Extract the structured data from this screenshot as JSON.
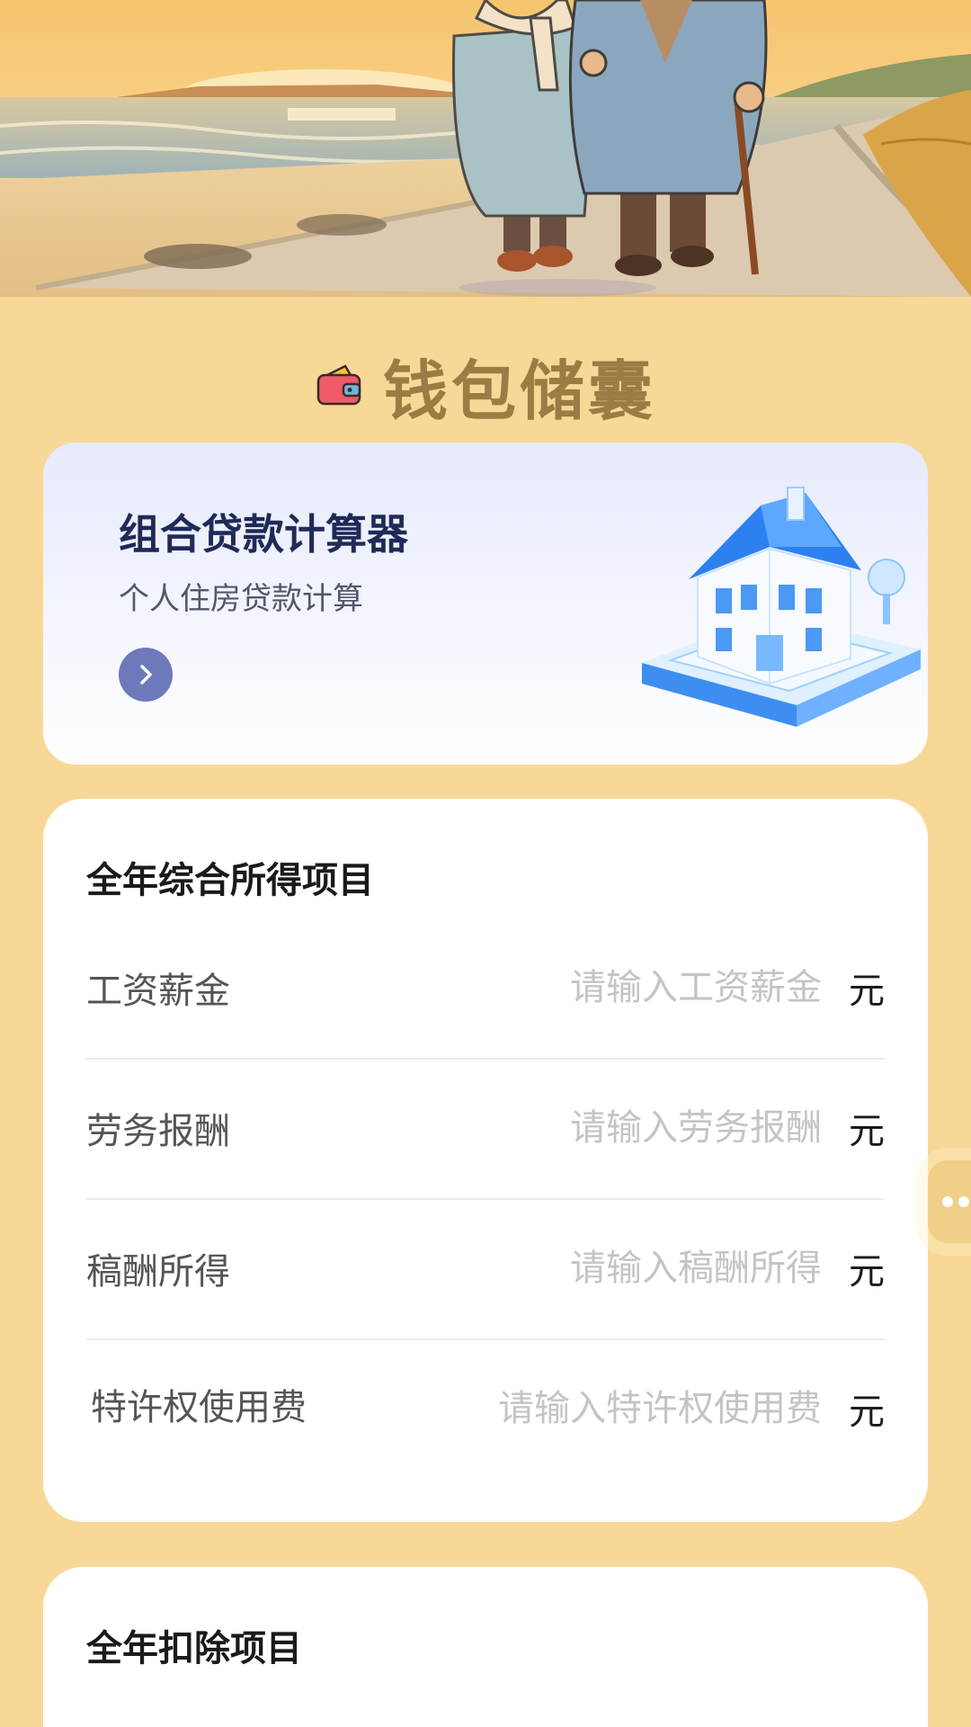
{
  "header": {
    "title": "钱包储囊",
    "icon": "wallet-icon"
  },
  "loan_card": {
    "title": "组合贷款计算器",
    "subtitle": "个人住房贷款计算",
    "arrow_icon": "chevron-right-icon",
    "illustration": "house-icon",
    "accent": "#6e79bc"
  },
  "income_section": {
    "title": "全年综合所得项目",
    "rows": [
      {
        "label": "工资薪金",
        "placeholder": "请输入工资薪金",
        "value": "",
        "unit": "元"
      },
      {
        "label": "劳务报酬",
        "placeholder": "请输入劳务报酬",
        "value": "",
        "unit": "元"
      },
      {
        "label": "稿酬所得",
        "placeholder": "请输入稿酬所得",
        "value": "",
        "unit": "元"
      },
      {
        "label": "特许权使用费",
        "placeholder": "请输入特许权使用费",
        "value": "",
        "unit": "元"
      }
    ]
  },
  "deduction_section": {
    "title": "全年扣除项目"
  },
  "colors": {
    "background": "#f7d897",
    "brand_text": "#9a7c44",
    "card": "#ffffff"
  }
}
